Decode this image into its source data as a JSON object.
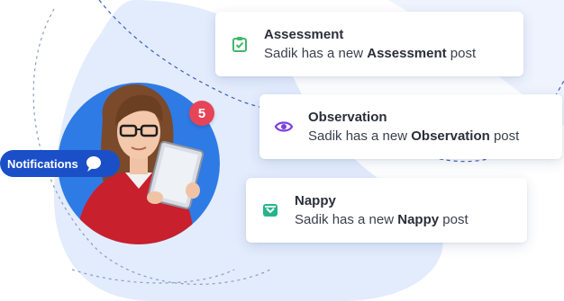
{
  "notifications_pill": {
    "label": "Notifications"
  },
  "badge": {
    "count": "5"
  },
  "cards": [
    {
      "title": "Assessment",
      "prefix": "Sadik has a new ",
      "keyword": "Assessment",
      "suffix": " post",
      "icon": "clipboard-check-icon",
      "icon_color": "#3fb86a"
    },
    {
      "title": "Observation",
      "prefix": "Sadik has a new ",
      "keyword": "Observation",
      "suffix": " post",
      "icon": "eye-icon",
      "icon_color": "#7a3fe0"
    },
    {
      "title": "Nappy",
      "prefix": "Sadik has a new ",
      "keyword": "Nappy",
      "suffix": " post",
      "icon": "nappy-icon",
      "icon_color": "#27b38c"
    }
  ],
  "colors": {
    "accent_blue": "#1b4fc7",
    "avatar_bg": "#2f7be5",
    "badge_red": "#e64557",
    "blob": "#dfe9fb"
  }
}
